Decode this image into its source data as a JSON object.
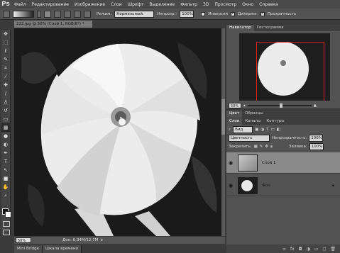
{
  "app": {
    "logo": "Ps"
  },
  "menu": [
    "Файл",
    "Редактирование",
    "Изображение",
    "Слои",
    "Шрифт",
    "Выделение",
    "Фильтр",
    "3D",
    "Просмотр",
    "Окно",
    "Справка"
  ],
  "options": {
    "mode_label": "Режим:",
    "mode_value": "Нормальный",
    "opacity_label": "Непрозр.:",
    "opacity_value": "100%",
    "invert_label": "Инверсия",
    "invert_checked": false,
    "dither_label": "Дизеринг",
    "dither_checked": true,
    "transparency_label": "Прозрачность",
    "transparency_checked": true
  },
  "document": {
    "tab_title": "222.jpg @ 50% (Слой 1, RGB/8*) *",
    "zoom": "50%",
    "doc_info": "Док: 6,34M/12,7M"
  },
  "bottom_tabs": [
    "Mini Bridge",
    "Шкала времени"
  ],
  "navigator": {
    "tabs": [
      "Навигатор",
      "Гистограмма"
    ],
    "zoom": "50%"
  },
  "color_tabs": [
    "Цвет",
    "Образцы"
  ],
  "layers": {
    "tabs": [
      "Слои",
      "Каналы",
      "Контуры"
    ],
    "filter_label": "Вид",
    "blend_mode": "Цветность",
    "opacity_label": "Непрозрачность:",
    "opacity_value": "100%",
    "lock_label": "Закрепить:",
    "fill_label": "Заливка:",
    "fill_value": "100%",
    "items": [
      {
        "name": "Слой 1",
        "selected": true
      },
      {
        "name": "Фон",
        "selected": false,
        "locked": true
      }
    ]
  },
  "tools": [
    "move-icon",
    "marquee-icon",
    "lasso-icon",
    "quick-select-icon",
    "crop-icon",
    "eyedropper-icon",
    "healing-icon",
    "brush-icon",
    "stamp-icon",
    "history-brush-icon",
    "eraser-icon",
    "gradient-icon",
    "blur-icon",
    "dodge-icon",
    "pen-icon",
    "type-icon",
    "path-select-icon",
    "shape-icon",
    "hand-icon",
    "zoom-icon"
  ]
}
